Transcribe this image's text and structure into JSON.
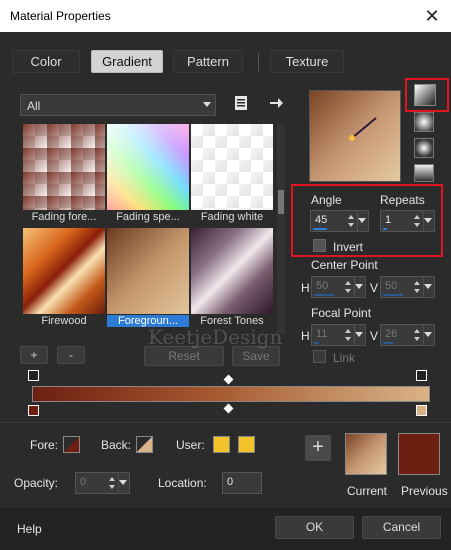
{
  "window": {
    "title": "Material Properties",
    "close_symbol": "✕"
  },
  "tabs": [
    {
      "label": "Color",
      "active": false
    },
    {
      "label": "Gradient",
      "active": true
    },
    {
      "label": "Pattern",
      "active": false
    },
    {
      "label": "Texture",
      "active": false
    }
  ],
  "category": {
    "selected": "All"
  },
  "gradients": [
    {
      "label": "Fading fore..."
    },
    {
      "label": "Fading spe..."
    },
    {
      "label": "Fading white"
    },
    {
      "label": "Firewood"
    },
    {
      "label": "Foregroun...",
      "selected": true
    },
    {
      "label": "Forest Tones"
    }
  ],
  "list_buttons": {
    "add": "+",
    "remove": "-",
    "reset": "Reset",
    "save": "Save"
  },
  "angle": {
    "label": "Angle",
    "value": "45"
  },
  "repeats": {
    "label": "Repeats",
    "value": "1"
  },
  "invert": {
    "label": "Invert",
    "checked": false
  },
  "center_point": {
    "label": "Center Point",
    "h_label": "H",
    "h_value": "50",
    "v_label": "V",
    "v_value": "50"
  },
  "focal_point": {
    "label": "Focal Point",
    "h_label": "H",
    "h_value": "11",
    "v_label": "V",
    "v_value": "26"
  },
  "link": {
    "label": "Link",
    "checked": false
  },
  "watermark": "KeetjeDesign",
  "stops": {
    "fore_label": "Fore:",
    "back_label": "Back:",
    "user_label": "User:",
    "opacity_label": "Opacity:",
    "opacity_value": "0",
    "location_label": "Location:",
    "location_value": "0"
  },
  "colors": {
    "foreground": "#6d1f12",
    "background": "#d9b387",
    "user": "#f2c32b",
    "accent": "#2e7bd6",
    "highlight": "#e0141e"
  },
  "preview": {
    "current_label": "Current",
    "previous_label": "Previous",
    "add_symbol": "+"
  },
  "footer": {
    "help": "Help",
    "ok": "OK",
    "cancel": "Cancel"
  }
}
